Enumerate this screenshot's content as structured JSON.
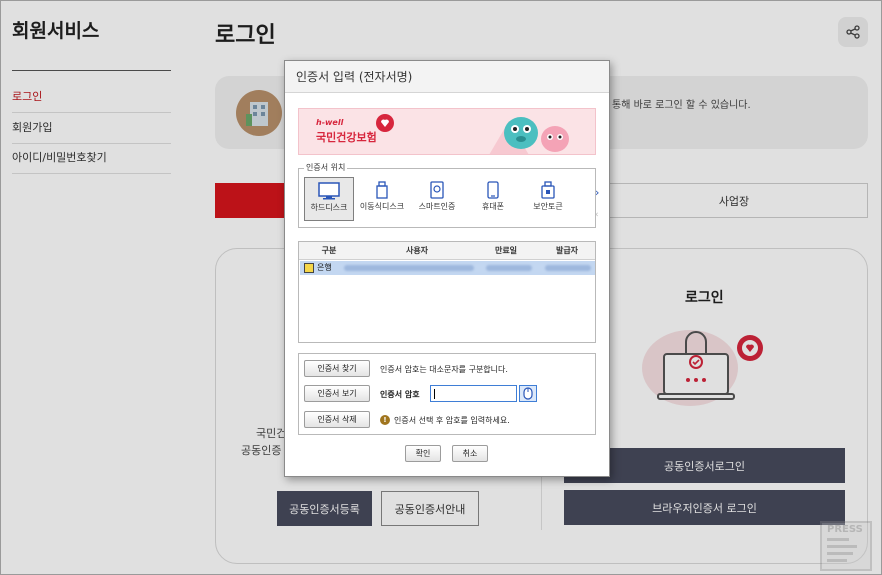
{
  "sidebar": {
    "title": "회원서비스",
    "items": [
      {
        "label": "로그인"
      },
      {
        "label": "회원가입"
      },
      {
        "label": "아이디/비밀번호찾기"
      }
    ]
  },
  "main": {
    "title": "로그인",
    "notice_text": "통해 바로 로그인 할 수 있습니다.",
    "tab_business": "사업장",
    "left_panel": {
      "line1": "국민건",
      "line2": "공동인증",
      "register_button": "공동인증서등록",
      "guide_button": "공동인증서안내"
    },
    "right_panel": {
      "title": "로그인",
      "cert_login_button": "공동인증서로그인",
      "browser_login_button": "브라우저인증서 로그인"
    },
    "watermark": "PRESS"
  },
  "dialog": {
    "title": "인증서 입력 (전자서명)",
    "banner_brand": "h-well",
    "banner_name": "국민건강보험",
    "location_legend": "인증서 위치",
    "locations": [
      {
        "label": "하드디스크",
        "icon": "monitor-icon",
        "selected": true
      },
      {
        "label": "이동식디스크",
        "icon": "usb-icon",
        "selected": false
      },
      {
        "label": "스마트인증",
        "icon": "smart-cert-icon",
        "selected": false
      },
      {
        "label": "휴대폰",
        "icon": "phone-icon",
        "selected": false
      },
      {
        "label": "보안토큰",
        "icon": "token-icon",
        "selected": false
      }
    ],
    "table_headers": [
      "구분",
      "사용자",
      "만료일",
      "발급자"
    ],
    "cert_row": {
      "type": "은행"
    },
    "find_button": "인증서 찾기",
    "view_button": "인증서 보기",
    "delete_button": "인증서 삭제",
    "case_notice": "인증서 암호는 대소문자를 구분합니다.",
    "password_label": "인증서 암호",
    "password_value": "",
    "warning_text": "인증서 선택 후 암호를 입력하세요.",
    "ok_button": "확인",
    "cancel_button": "취소"
  },
  "colors": {
    "accent_red": "#d7151c",
    "button_dark": "#474a5d",
    "selection_blue": "#c3d7f1"
  }
}
